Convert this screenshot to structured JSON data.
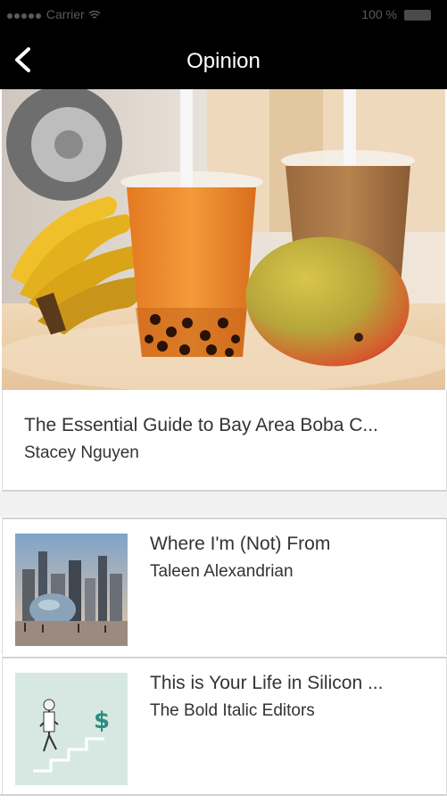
{
  "status_bar": {
    "carrier": "Carrier",
    "time": "",
    "battery": "100 %"
  },
  "nav": {
    "title": "Opinion"
  },
  "featured": {
    "title": "The Essential Guide to Bay Area Boba C...",
    "author": "Stacey Nguyen"
  },
  "articles": [
    {
      "title": "Where I'm (Not) From",
      "author": "Taleen Alexandrian"
    },
    {
      "title": "This is Your Life in Silicon ...",
      "author": "The Bold Italic Editors"
    }
  ],
  "icons": {
    "back": "chevron-left-icon",
    "wifi": "wifi-icon",
    "battery": "battery-icon"
  },
  "colors": {
    "header": "#000000",
    "text": "#333333",
    "divider": "#d3d3d3"
  }
}
